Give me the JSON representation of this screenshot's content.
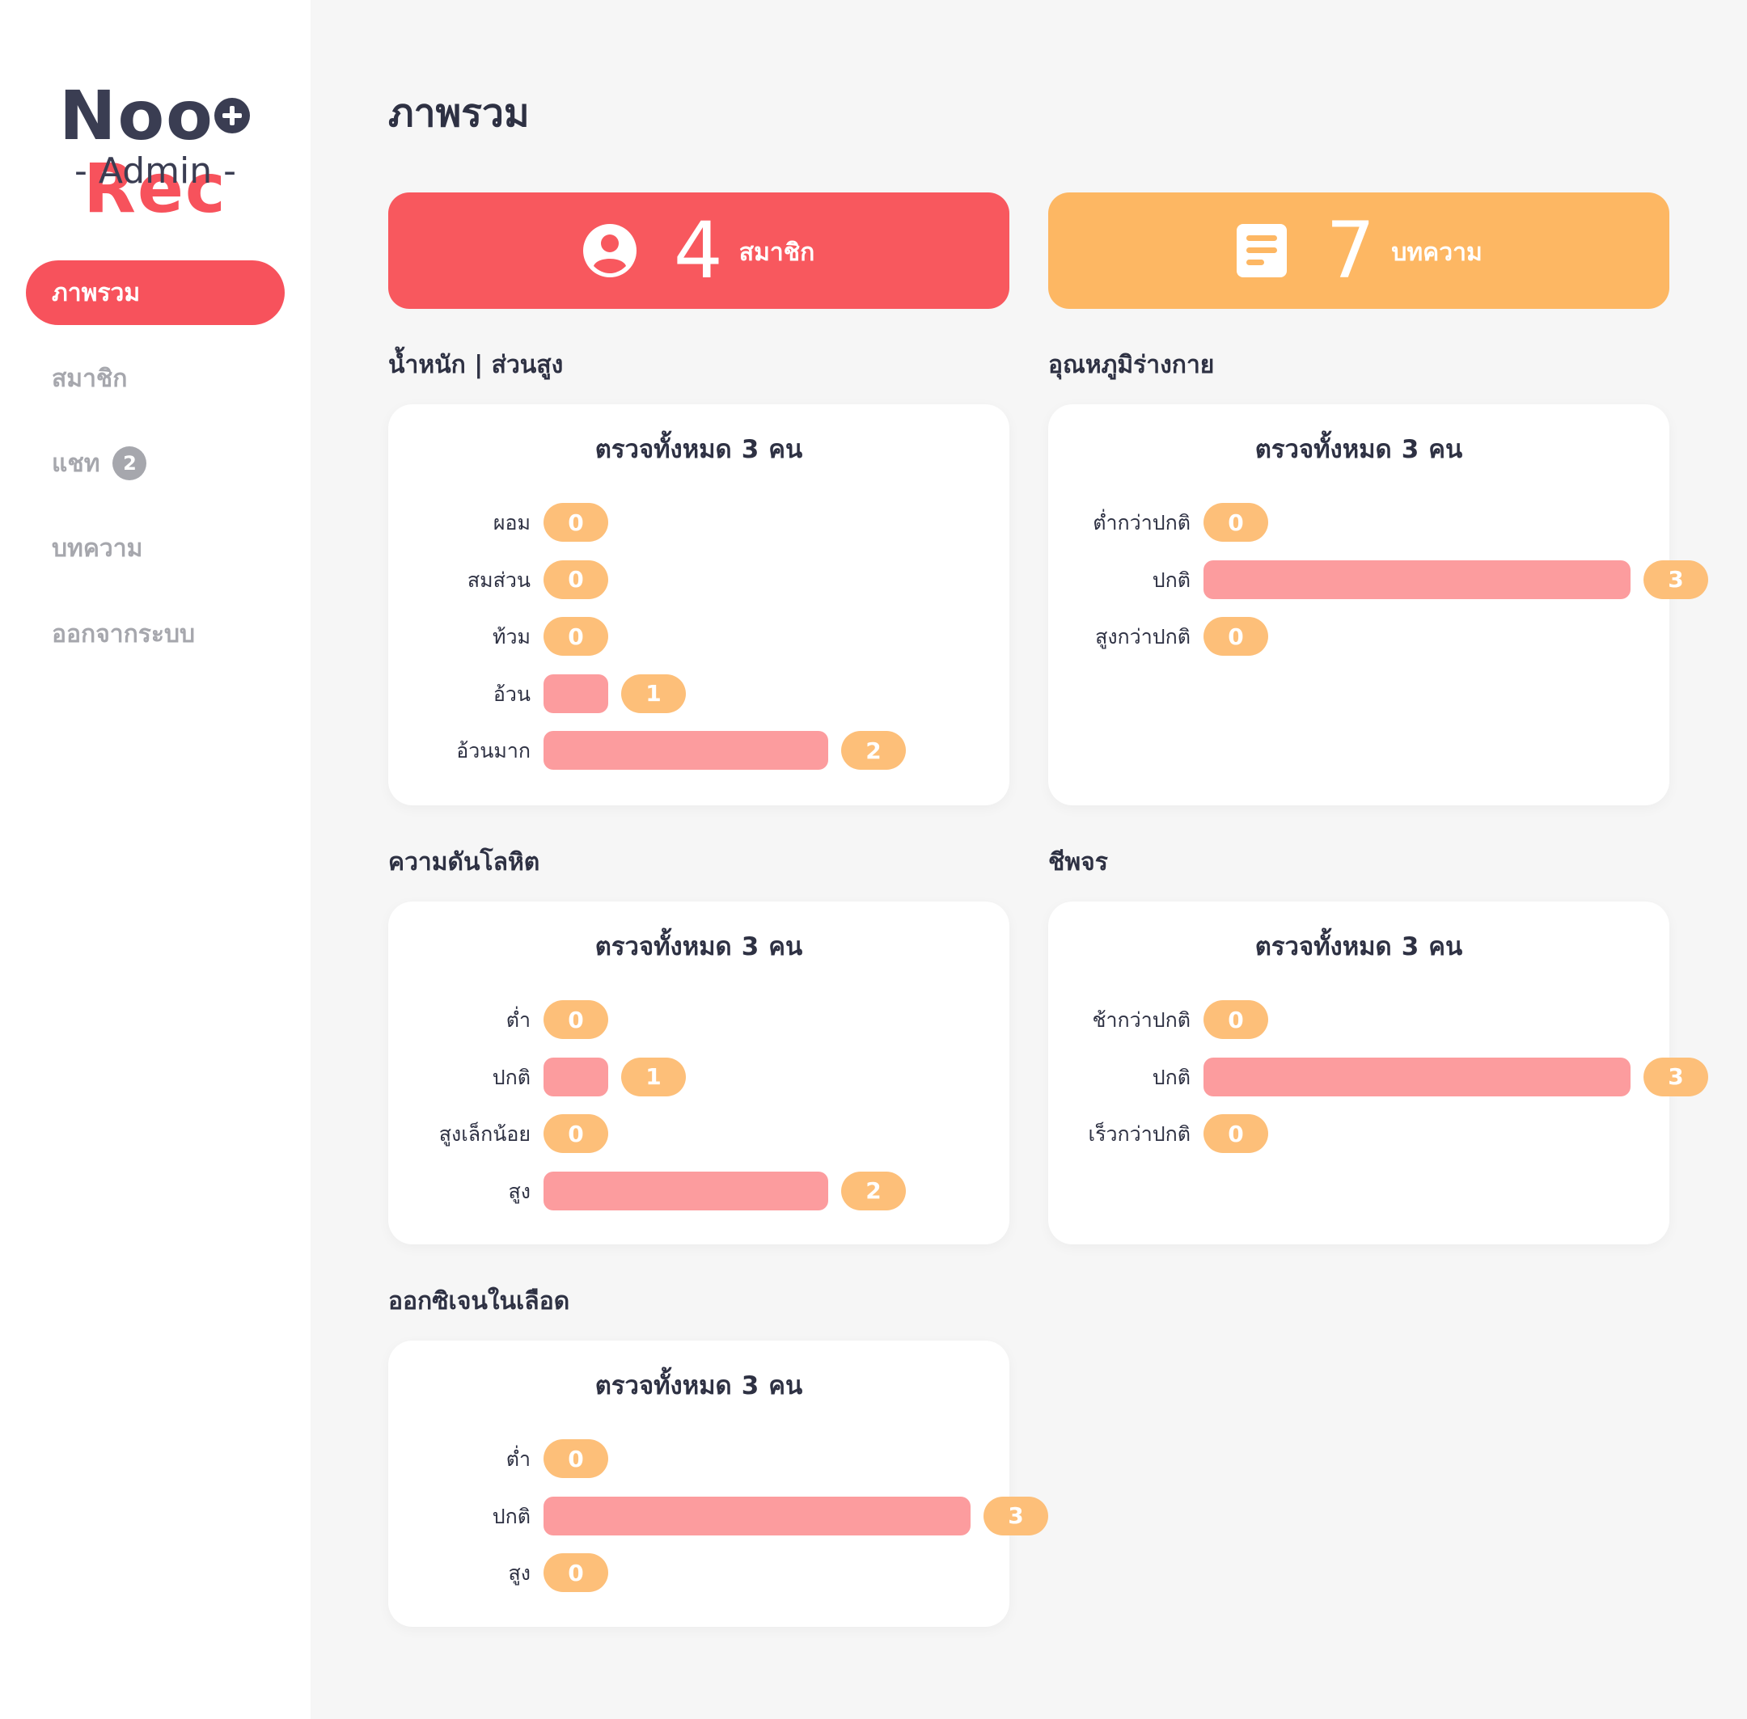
{
  "sidebar": {
    "logo_part1": "Noo",
    "logo_part2": "Rec",
    "subtitle": "- Admin -",
    "items": [
      {
        "label": "ภาพรวม"
      },
      {
        "label": "สมาชิก"
      },
      {
        "label": "แชท",
        "badge": "2"
      },
      {
        "label": "บทความ"
      },
      {
        "label": "ออกจากระบบ"
      }
    ]
  },
  "page_title": "ภาพรวม",
  "stats": {
    "members": {
      "value": "4",
      "label": "สมาชิก",
      "icon": "user-circle-icon"
    },
    "articles": {
      "value": "7",
      "label": "บทความ",
      "icon": "document-icon"
    }
  },
  "colors": {
    "primary": "#f7525c",
    "orange": "#fdb763",
    "bar": "#fc9c9e",
    "pill": "#fdbf79",
    "text": "#2e3143",
    "muted": "#a6a7ad"
  },
  "panels": [
    {
      "section": "น้ำหนัก | ส่วนสูง",
      "header_prefix": "ตรวจทั้งหมด",
      "total": "3",
      "header_suffix": "คน",
      "rows": [
        {
          "label": "ผอม",
          "value": 0
        },
        {
          "label": "สมส่วน",
          "value": 0
        },
        {
          "label": "ท้วม",
          "value": 0
        },
        {
          "label": "อ้วน",
          "value": 1
        },
        {
          "label": "อ้วนมาก",
          "value": 2
        }
      ]
    },
    {
      "section": "อุณหภูมิร่างกาย",
      "header_prefix": "ตรวจทั้งหมด",
      "total": "3",
      "header_suffix": "คน",
      "rows": [
        {
          "label": "ต่ำกว่าปกติ",
          "value": 0
        },
        {
          "label": "ปกติ",
          "value": 3
        },
        {
          "label": "สูงกว่าปกติ",
          "value": 0
        }
      ]
    },
    {
      "section": "ความดันโลหิต",
      "header_prefix": "ตรวจทั้งหมด",
      "total": "3",
      "header_suffix": "คน",
      "rows": [
        {
          "label": "ต่ำ",
          "value": 0
        },
        {
          "label": "ปกติ",
          "value": 1
        },
        {
          "label": "สูงเล็กน้อย",
          "value": 0
        },
        {
          "label": "สูง",
          "value": 2
        }
      ]
    },
    {
      "section": "ชีพจร",
      "header_prefix": "ตรวจทั้งหมด",
      "total": "3",
      "header_suffix": "คน",
      "rows": [
        {
          "label": "ช้ากว่าปกติ",
          "value": 0
        },
        {
          "label": "ปกติ",
          "value": 3
        },
        {
          "label": "เร็วกว่าปกติ",
          "value": 0
        }
      ]
    },
    {
      "section": "ออกซิเจนในเลือด",
      "header_prefix": "ตรวจทั้งหมด",
      "total": "3",
      "header_suffix": "คน",
      "rows": [
        {
          "label": "ต่ำ",
          "value": 0
        },
        {
          "label": "ปกติ",
          "value": 3
        },
        {
          "label": "สูง",
          "value": 0
        }
      ]
    }
  ]
}
